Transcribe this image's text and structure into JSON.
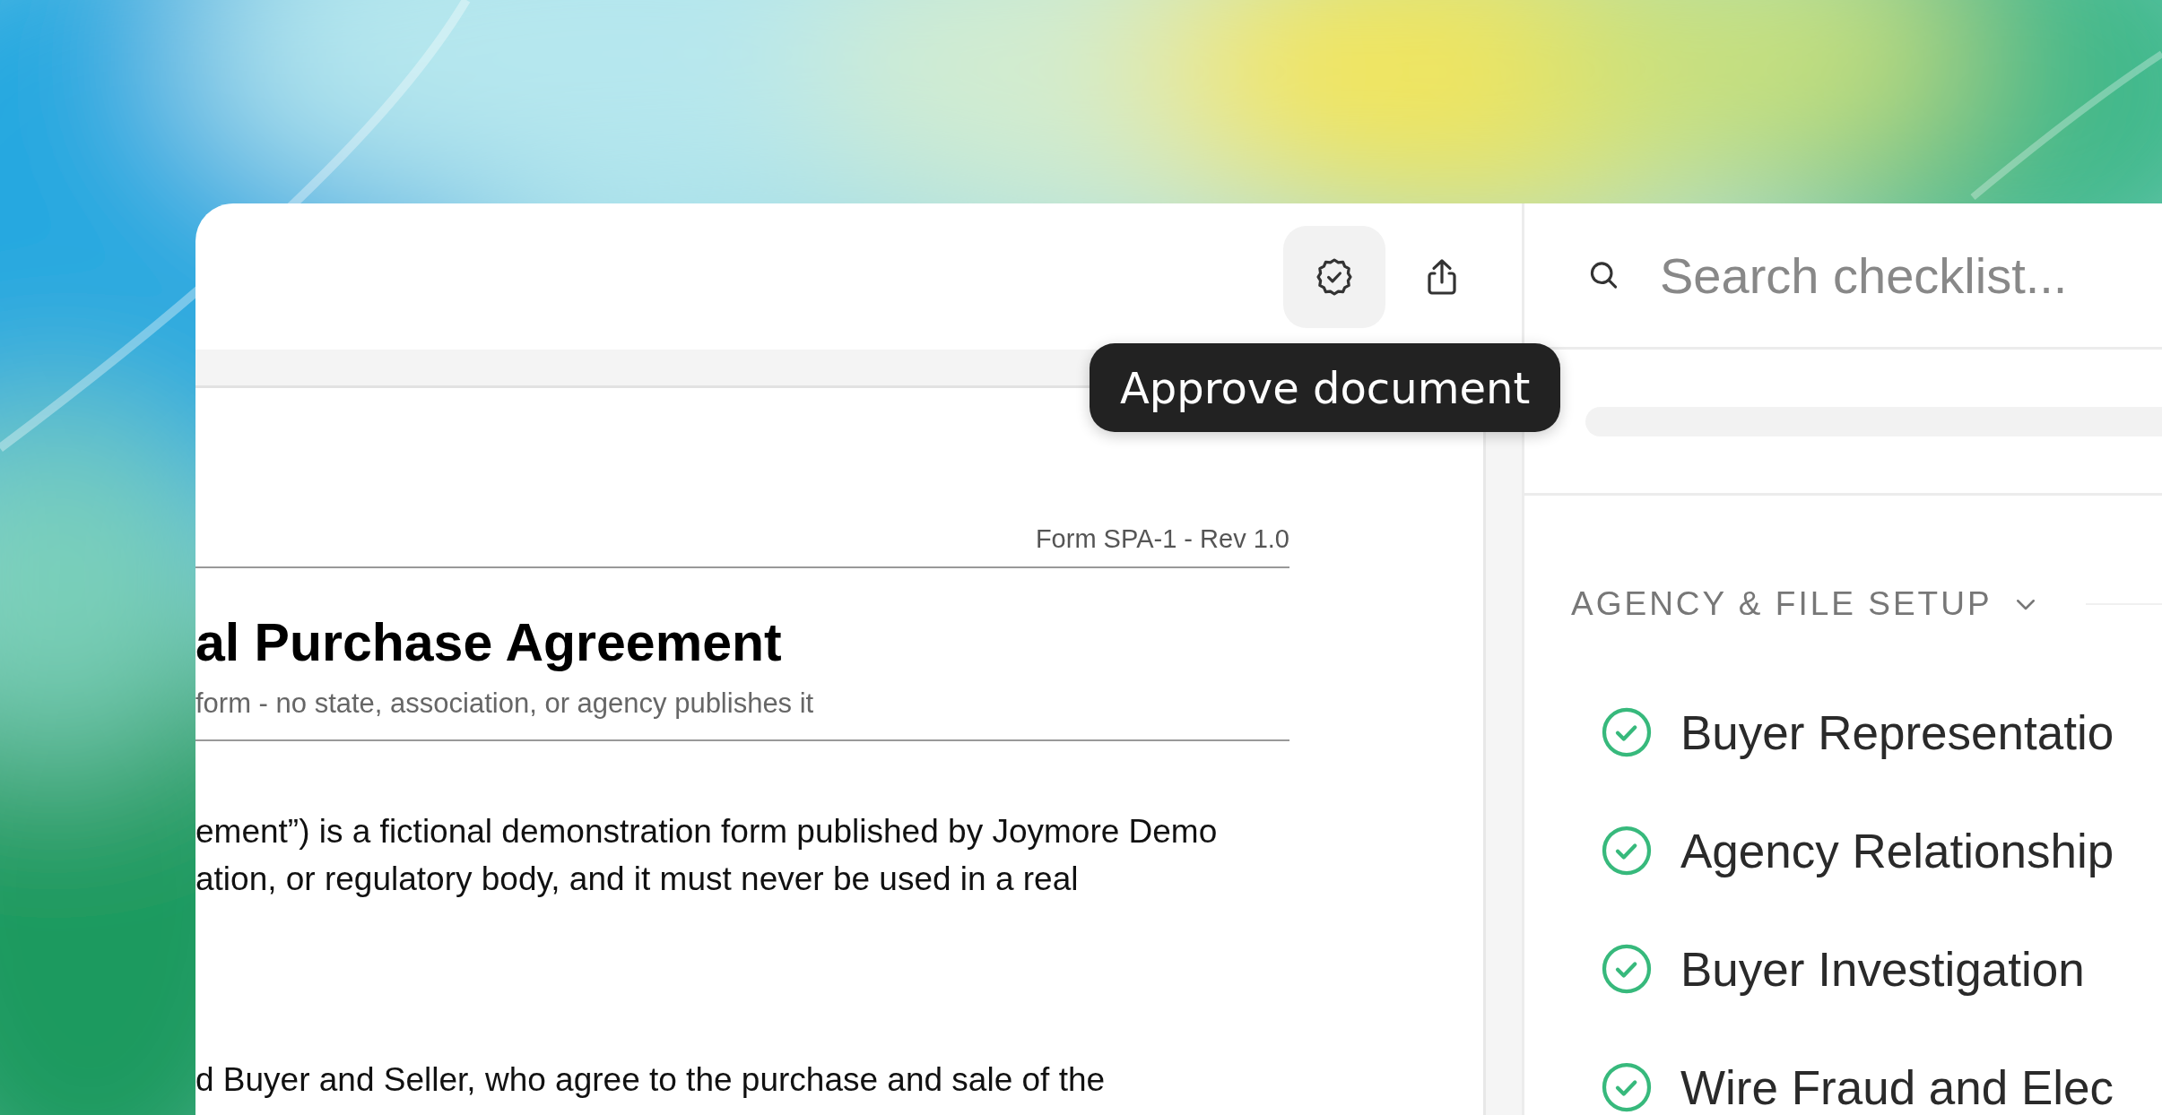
{
  "toolbar": {
    "buttons": [
      {
        "kind": "approve",
        "hovered": true
      },
      {
        "kind": "share",
        "hovered": false
      }
    ]
  },
  "tooltip": {
    "text": "Approve document"
  },
  "document": {
    "form_id": "Form SPA-1 - Rev 1.0",
    "title": "al Purchase Agreement",
    "subtitle": "form - no state, association, or agency publishes it",
    "paragraphs": [
      {
        "lines": [
          "ement”) is a fictional demonstration form published by Joymore Demo",
          "ation, or regulatory body, and it must never be used in a real"
        ]
      },
      {
        "lines": [
          "d Buyer and Seller, who agree to the purchase and sale of the"
        ]
      }
    ]
  },
  "checklist": {
    "search": {
      "placeholder": "Search checklist..."
    },
    "section": {
      "title": "AGENCY & FILE SETUP",
      "expanded": true
    },
    "items": [
      {
        "label": "Buyer Representatio",
        "done": true
      },
      {
        "label": "Agency Relationship",
        "done": true
      },
      {
        "label": "Buyer Investigation",
        "done": true
      },
      {
        "label": "Wire Fraud and Elec",
        "done": true
      }
    ]
  }
}
